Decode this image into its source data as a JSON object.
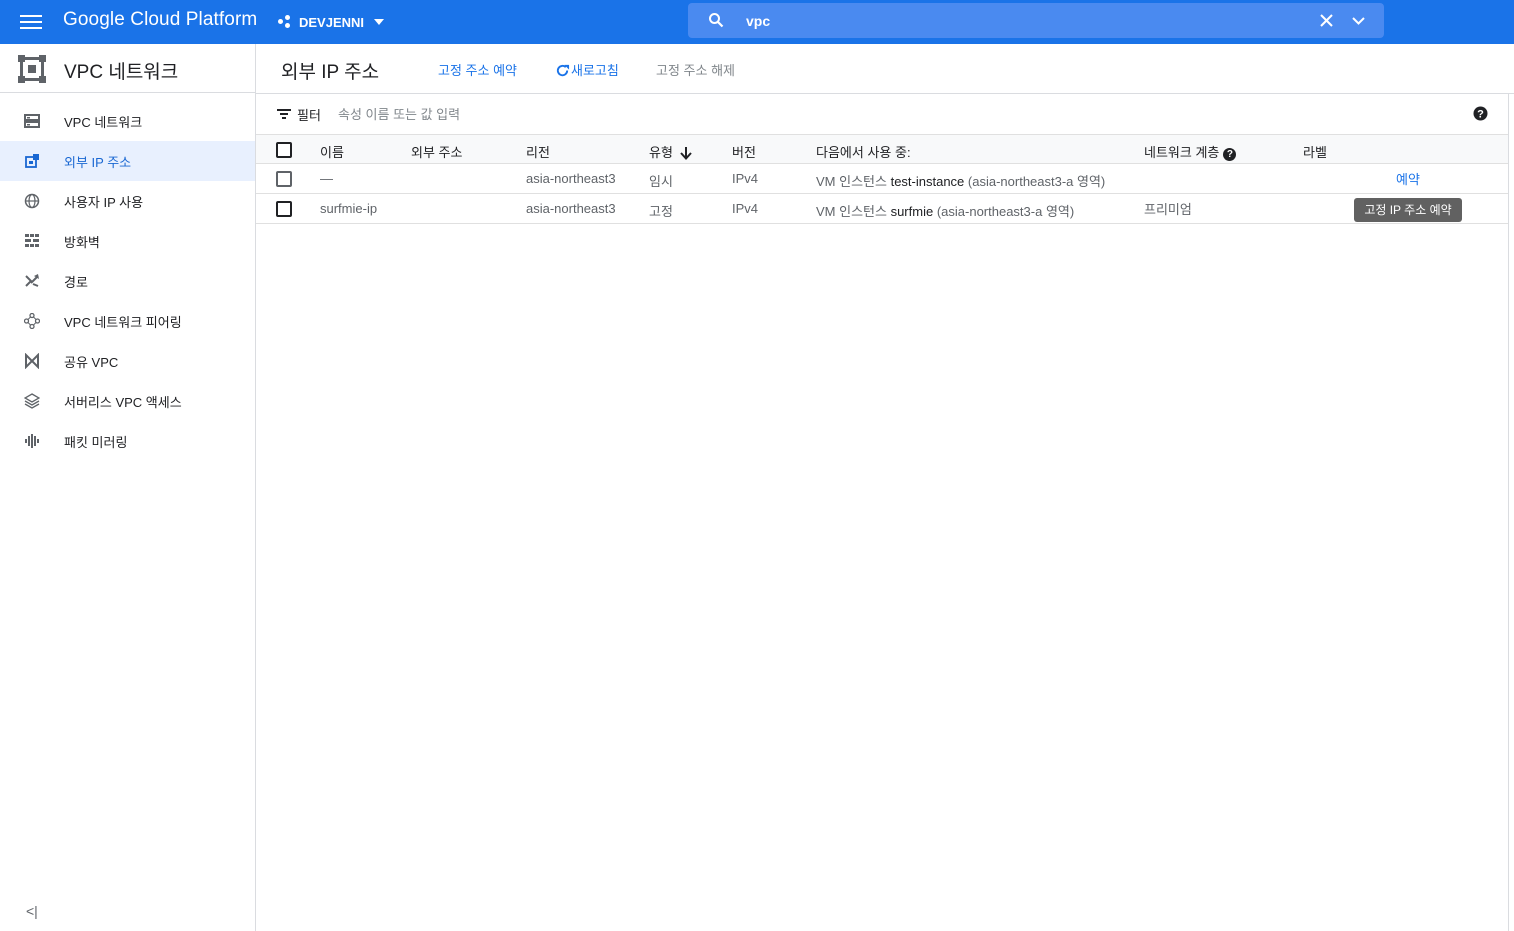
{
  "topbar": {
    "brand": "Google Cloud Platform",
    "project": "DEVJENNI",
    "search_value": "vpc"
  },
  "sidebar": {
    "title": "VPC 네트워크",
    "items": [
      {
        "label": "VPC 네트워크",
        "icon": "vpc-network-icon"
      },
      {
        "label": "외부 IP 주소",
        "icon": "external-ip-icon",
        "active": true
      },
      {
        "label": "사용자 IP 사용",
        "icon": "globe-icon"
      },
      {
        "label": "방화벽",
        "icon": "firewall-icon"
      },
      {
        "label": "경로",
        "icon": "routes-icon"
      },
      {
        "label": "VPC 네트워크 피어링",
        "icon": "peering-icon"
      },
      {
        "label": "공유 VPC",
        "icon": "shared-vpc-icon"
      },
      {
        "label": "서버리스 VPC 액세스",
        "icon": "serverless-icon"
      },
      {
        "label": "패킷 미러링",
        "icon": "packet-mirroring-icon"
      }
    ],
    "collapse_glyph": "<|"
  },
  "page": {
    "title": "외부 IP 주소",
    "actions": {
      "reserve": "고정 주소 예약",
      "refresh": "새로고침",
      "release": "고정 주소 해제"
    }
  },
  "filter": {
    "label": "필터",
    "placeholder": "속성 이름 또는 값 입력"
  },
  "table": {
    "headers": {
      "name": "이름",
      "external_address": "외부 주소",
      "region": "리전",
      "type": "유형",
      "version": "버전",
      "in_use_by": "다음에서 사용 중:",
      "network_tier": "네트워크 계층",
      "labels": "라벨"
    },
    "rows": [
      {
        "name": "—",
        "external_address": "",
        "region": "asia-northeast3",
        "type": "임시",
        "version": "IPv4",
        "in_use_prefix": "VM 인스턴스",
        "in_use_name": "test-instance",
        "in_use_suffix": "(asia-northeast3-a 영역)",
        "network_tier": "",
        "action": "예약"
      },
      {
        "name": "surfmie-ip",
        "external_address": "",
        "region": "asia-northeast3",
        "type": "고정",
        "version": "IPv4",
        "in_use_prefix": "VM 인스턴스",
        "in_use_name": "surfmie",
        "in_use_suffix": "(asia-northeast3-a 영역)",
        "network_tier": "프리미엄",
        "action": ""
      }
    ]
  },
  "tooltip": "고정 IP 주소 예약",
  "colors": {
    "topbar": "#1a73e8",
    "link": "#1a73e8",
    "active_bg": "#e8f0fe"
  }
}
